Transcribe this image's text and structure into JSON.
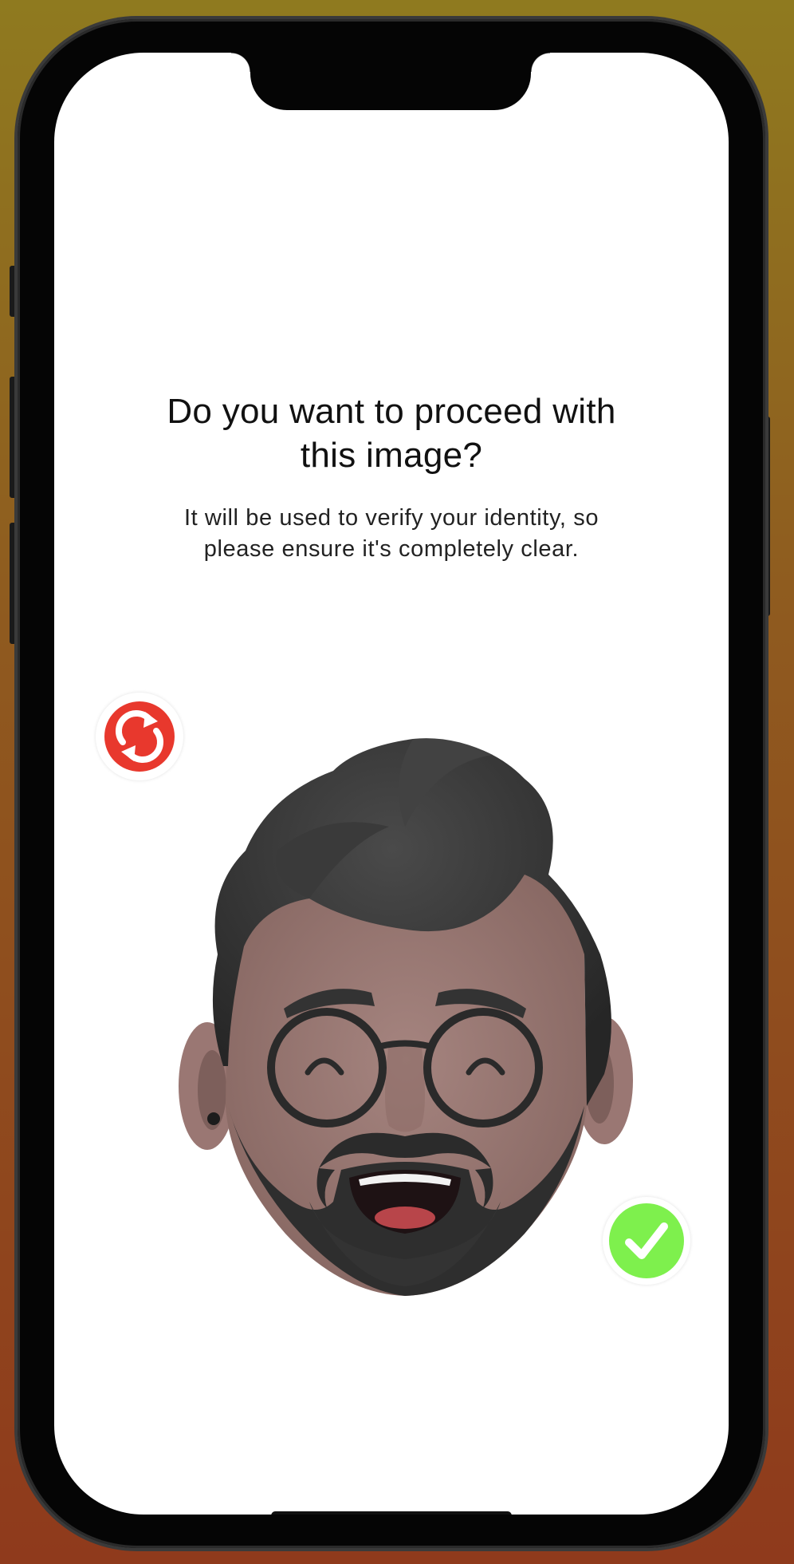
{
  "dialog": {
    "title": "Do you want to proceed with\nthis image?",
    "subtitle": "It will be used to verify your identity, so\nplease ensure it's completely clear."
  },
  "actions": {
    "retake": {
      "icon": "refresh-icon",
      "color": "#e8382d"
    },
    "confirm": {
      "icon": "checkmark-icon",
      "color": "#7ef04d"
    }
  },
  "colors": {
    "background_top": "#8f7a1f",
    "background_bottom": "#8f3a1c",
    "skin": "#9c7a76",
    "hair": "#363636"
  }
}
